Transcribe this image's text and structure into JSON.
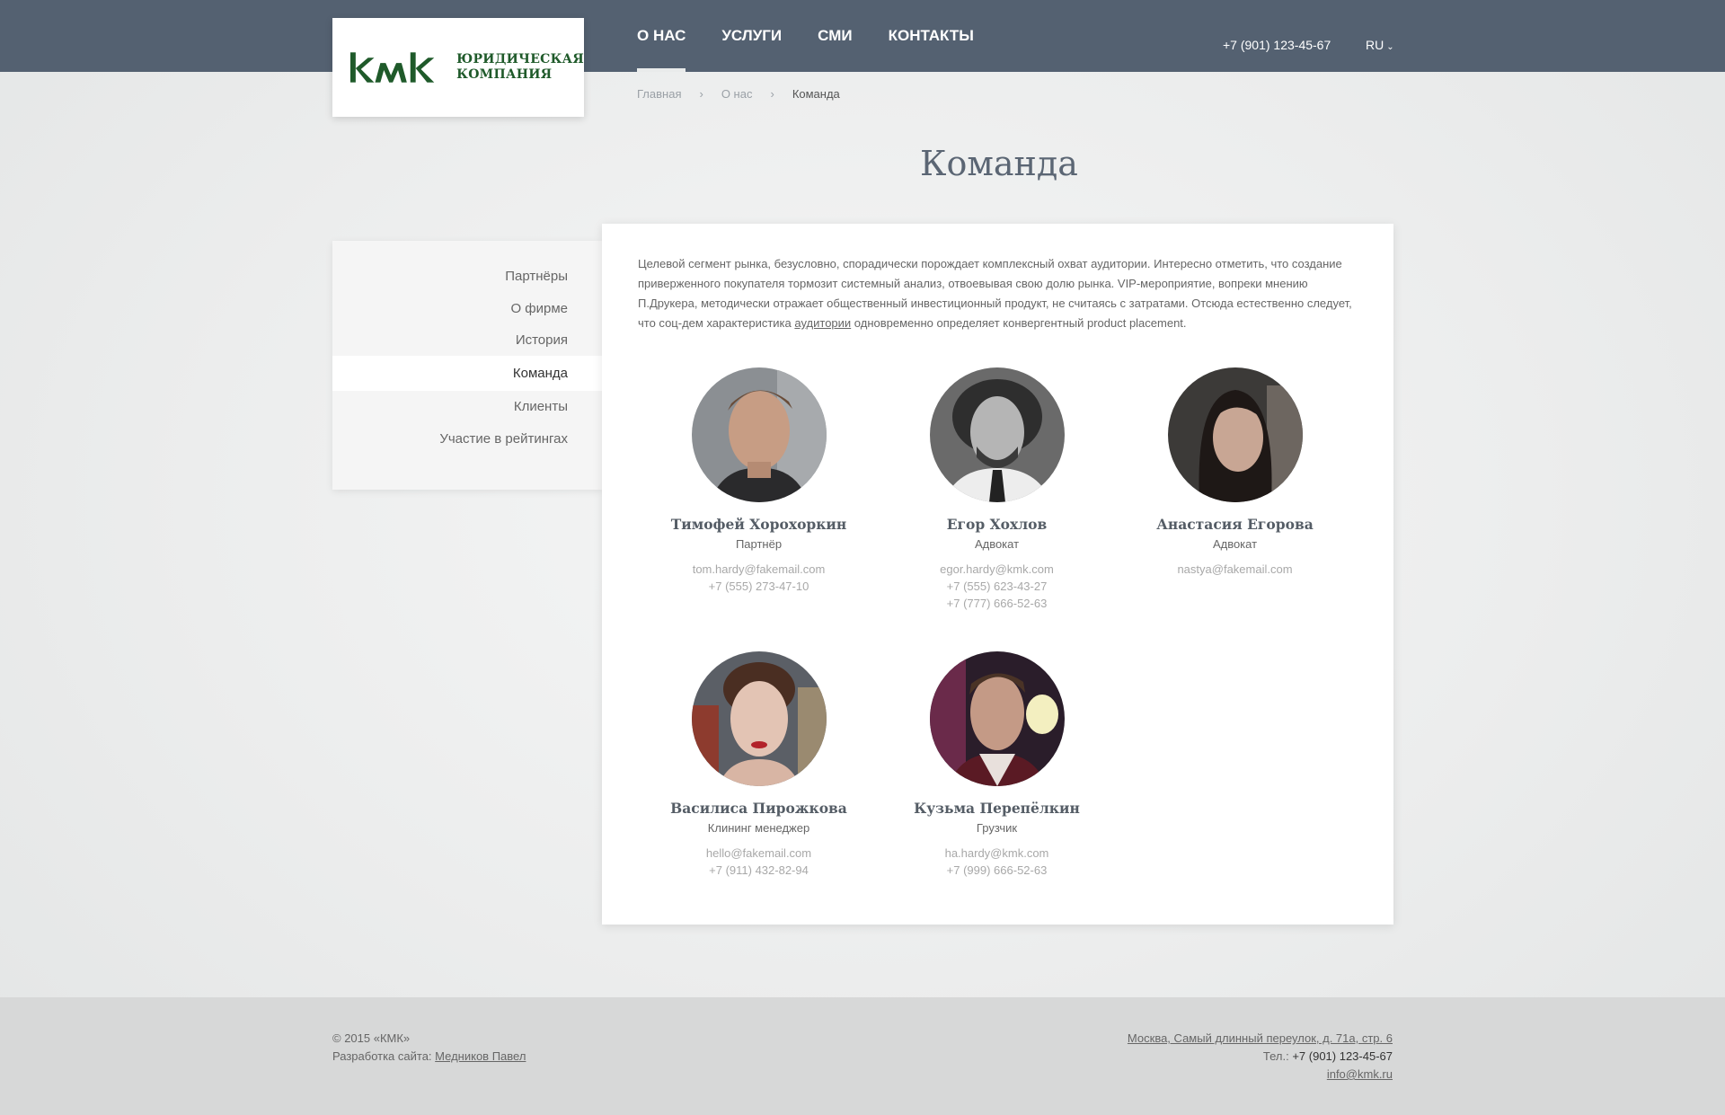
{
  "header": {
    "logo_text_line1": "ЮРИДИЧЕСКАЯ",
    "logo_text_line2": "КОМПАНИЯ",
    "nav": [
      {
        "label": "О НАС",
        "active": true
      },
      {
        "label": "УСЛУГИ"
      },
      {
        "label": "СМИ"
      },
      {
        "label": "КОНТАКТЫ"
      }
    ],
    "phone": "+7 (901) 123-45-67",
    "lang": "RU"
  },
  "breadcrumb": [
    "Главная",
    "О нас",
    "Команда"
  ],
  "page_title": "Команда",
  "sidebar": {
    "items": [
      "Партнёры",
      "О фирме",
      "История",
      "Команда",
      "Клиенты",
      "Участие в рейтингах"
    ],
    "active": "Команда"
  },
  "intro": {
    "text_before": "Целевой сегмент рынка, безусловно, спорадически порождает комплексный охват аудитории. Интересно отметить, что создание приверженного покупателя тормозит системный анализ, отвоевывая свою долю рынка. VIP-мероприятие, вопреки мнению П.Друкера, методически отражает общественный инвестиционный продукт, не считаясь с затратами. Отсюда естественно следует, что соц-дем характеристика ",
    "link": "аудитории",
    "text_after": " одновременно определяет конвергентный product placement."
  },
  "team": [
    {
      "name": "Тимофей Хорохоркин",
      "role": "Партнёр",
      "email": "tom.hardy@fakemail.com",
      "phones": [
        "+7 (555) 273-47-10"
      ]
    },
    {
      "name": "Егор Хохлов",
      "role": "Адвокат",
      "email": "egor.hardy@kmk.com",
      "phones": [
        "+7 (555) 623-43-27",
        "+7 (777) 666-52-63"
      ]
    },
    {
      "name": "Анастасия Егорова",
      "role": "Адвокат",
      "email": "nastya@fakemail.com",
      "phones": []
    },
    {
      "name": "Василиса Пирожкова",
      "role": "Клининг менеджер",
      "email": "hello@fakemail.com",
      "phones": [
        "+7 (911) 432-82-94"
      ]
    },
    {
      "name": "Кузьма Перепёлкин",
      "role": "Грузчик",
      "email": "ha.hardy@kmk.com",
      "phones": [
        "+7 (999) 666-52-63"
      ]
    }
  ],
  "footer": {
    "copyright": "© 2015 «КМК»",
    "dev_label": "Разработка сайта:",
    "dev_name": "Медников Павел",
    "address": "Москва, Самый длинный переулок, д. 71а, стр. 6",
    "tel_label": "Тел.:",
    "tel": "+7 (901) 123-45-67",
    "email": "info@kmk.ru"
  },
  "colors": {
    "header_bg": "#546171",
    "logo_green": "#1f5a2a",
    "footer_bg": "#d7d8d8"
  }
}
